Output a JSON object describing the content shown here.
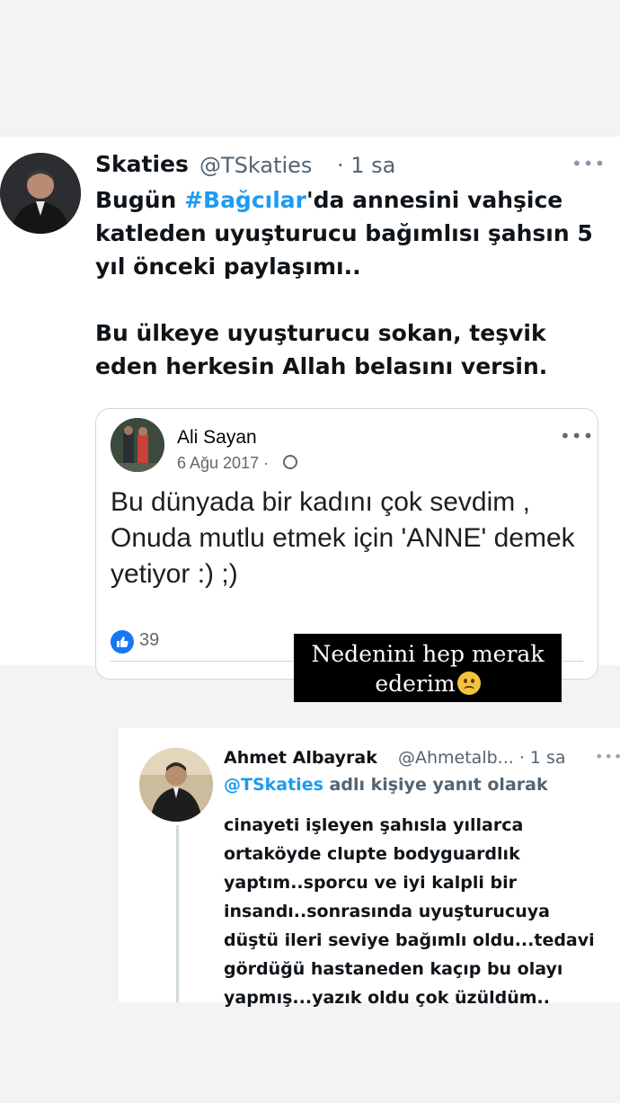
{
  "tweet": {
    "name": "Skaties",
    "handle": "@TSkaties",
    "time": "· 1 sa",
    "text_part1": "Bugün ",
    "hashtag": "#Bağcılar",
    "text_part2": "'da annesini vahşice katleden uyuşturucu bağımlısı şahsın 5 yıl önceki paylaşımı..",
    "text_body2": "Bu ülkeye uyuşturucu sokan, teşvik eden herkesin Allah belasını versin.",
    "more": "•••"
  },
  "fb_post": {
    "author": "Ali Sayan",
    "date": "6 Ağu 2017 ·",
    "text": "Bu dünyada bir kadını çok sevdim , Onuda mutlu etmek için 'ANNE' demek yetiyor :) ;)",
    "like_count": "39",
    "more": "•••"
  },
  "caption": {
    "line1": "Nedenini hep merak",
    "line2": "ederim"
  },
  "reply": {
    "name": "Ahmet Albayrak",
    "handle": "@Ahmetalb... · 1 sa",
    "reply_mention": "@TSkaties",
    "reply_suffix": " adlı kişiye yanıt olarak",
    "text": "cinayeti işleyen şahısla yıllarca ortaköyde clupte bodyguardlık yaptım..sporcu ve iyi kalpli bir insandı..sonrasında uyuşturucuya düştü ileri seviye bağımlı oldu...tedavi gördüğü hastaneden kaçıp bu olayı yapmış...yazık oldu çok üzüldüm..",
    "more": "•••"
  },
  "colors": {
    "link_blue": "#1d9bf0",
    "fb_blue": "#1877f2",
    "muted": "#536471"
  }
}
